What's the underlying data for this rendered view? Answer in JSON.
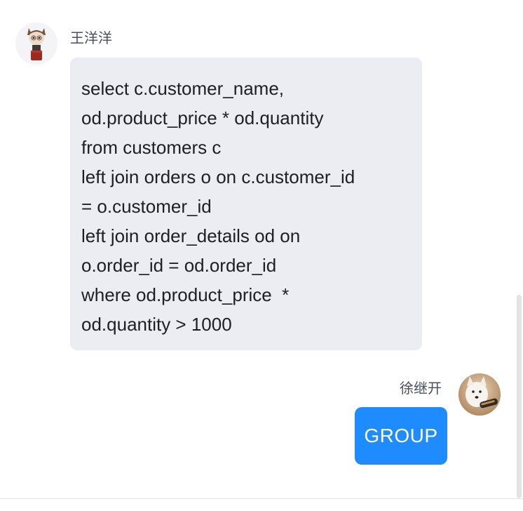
{
  "messages": [
    {
      "direction": "incoming",
      "sender": "王洋洋",
      "avatar_icon": "cartoon-character-avatar",
      "lines": [
        "select c.customer_name,",
        "od.product_price * od.quantity",
        "from customers c",
        "left join orders o on c.customer_id",
        "= o.customer_id",
        "left join order_details od on",
        "o.order_id = od.order_id",
        "where od.product_price  *",
        "od.quantity > 1000"
      ],
      "bubble_color": "#ebedf2"
    },
    {
      "direction": "outgoing",
      "sender": "徐继开",
      "avatar_icon": "dog-photo-avatar",
      "text": "GROUP",
      "bubble_color": "#1e8cff"
    }
  ]
}
